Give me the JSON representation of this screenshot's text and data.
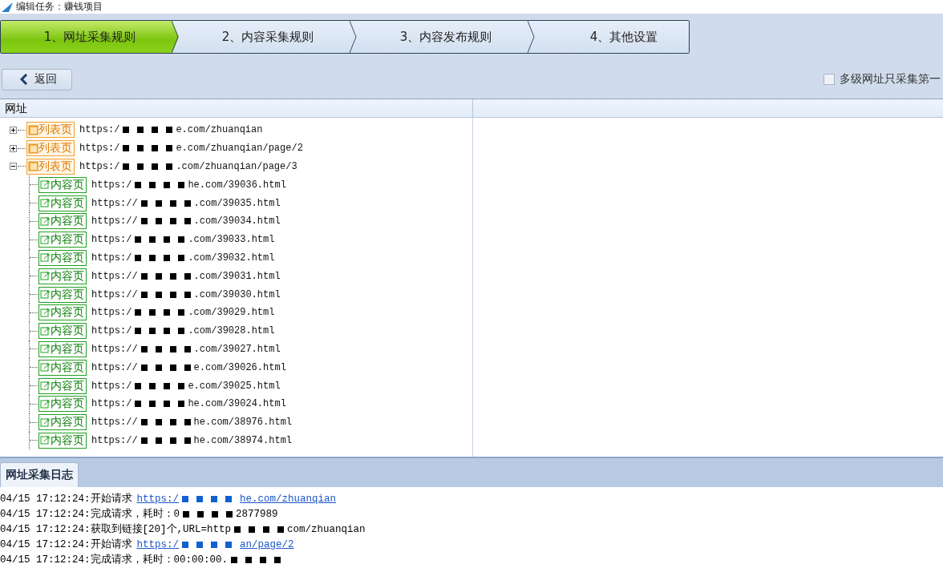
{
  "window": {
    "title": "编辑任务：赚钱项目"
  },
  "steps": [
    {
      "label": "1、网址采集规则",
      "selected": true
    },
    {
      "label": "2、内容采集规则",
      "selected": false
    },
    {
      "label": "3、内容发布规则",
      "selected": false
    },
    {
      "label": "4、其他设置",
      "selected": false
    }
  ],
  "back_button": "返回",
  "option": {
    "label": "多级网址只采集第一",
    "checked": false
  },
  "table": {
    "columns": [
      "网址"
    ],
    "rows": [
      {
        "badge": "列表页",
        "url_start": "https:/",
        "url_end": "e.com/zhuanqian",
        "expanded": false,
        "children": []
      },
      {
        "badge": "列表页",
        "url_start": "https:/",
        "url_end": "e.com/zhuanqian/page/2",
        "expanded": false,
        "children": []
      },
      {
        "badge": "列表页",
        "url_start": "https:/",
        "url_end": ".com/zhuanqian/page/3",
        "expanded": true,
        "children": [
          {
            "badge": "内容页",
            "url_start": "https:/",
            "url_end": "he.com/39036.html"
          },
          {
            "badge": "内容页",
            "url_start": "https://",
            "url_end": ".com/39035.html"
          },
          {
            "badge": "内容页",
            "url_start": "https://",
            "url_end": ".com/39034.html"
          },
          {
            "badge": "内容页",
            "url_start": "https:/",
            "url_end": ".com/39033.html"
          },
          {
            "badge": "内容页",
            "url_start": "https:/",
            "url_end": ".com/39032.html"
          },
          {
            "badge": "内容页",
            "url_start": "https://",
            "url_end": ".com/39031.html"
          },
          {
            "badge": "内容页",
            "url_start": "https://",
            "url_end": ".com/39030.html"
          },
          {
            "badge": "内容页",
            "url_start": "https:/",
            "url_end": ".com/39029.html"
          },
          {
            "badge": "内容页",
            "url_start": "https:/",
            "url_end": ".com/39028.html"
          },
          {
            "badge": "内容页",
            "url_start": "https://",
            "url_end": ".com/39027.html"
          },
          {
            "badge": "内容页",
            "url_start": "https://",
            "url_end": "e.com/39026.html"
          },
          {
            "badge": "内容页",
            "url_start": "https:/",
            "url_end": "e.com/39025.html"
          },
          {
            "badge": "内容页",
            "url_start": "https:/",
            "url_end": "he.com/39024.html"
          },
          {
            "badge": "内容页",
            "url_start": "https://",
            "url_end": "he.com/38976.html"
          },
          {
            "badge": "内容页",
            "url_start": "https://",
            "url_end": "he.com/38974.html"
          }
        ]
      }
    ]
  },
  "log": {
    "tab": "网址采集日志",
    "lines": [
      {
        "kind": "link",
        "text": "04/15 17:12:24:开始请求",
        "url_start": "https:/",
        "url_end": "he.com/zhuanqian"
      },
      {
        "kind": "text",
        "text": "04/15 17:12:24:完成请求，耗时：0",
        "url_end": "2877989"
      },
      {
        "kind": "text",
        "text": "04/15 17:12:24:获取到链接[20]个,URL=http",
        "url_end": "com/zhuanqian"
      },
      {
        "kind": "link",
        "text": "04/15 17:12:24:开始请求",
        "url_start": "https:/",
        "url_end": "an/page/2"
      },
      {
        "kind": "text",
        "text": "04/15 17:12:24:完成请求，耗时：00:00:00."
      }
    ]
  }
}
